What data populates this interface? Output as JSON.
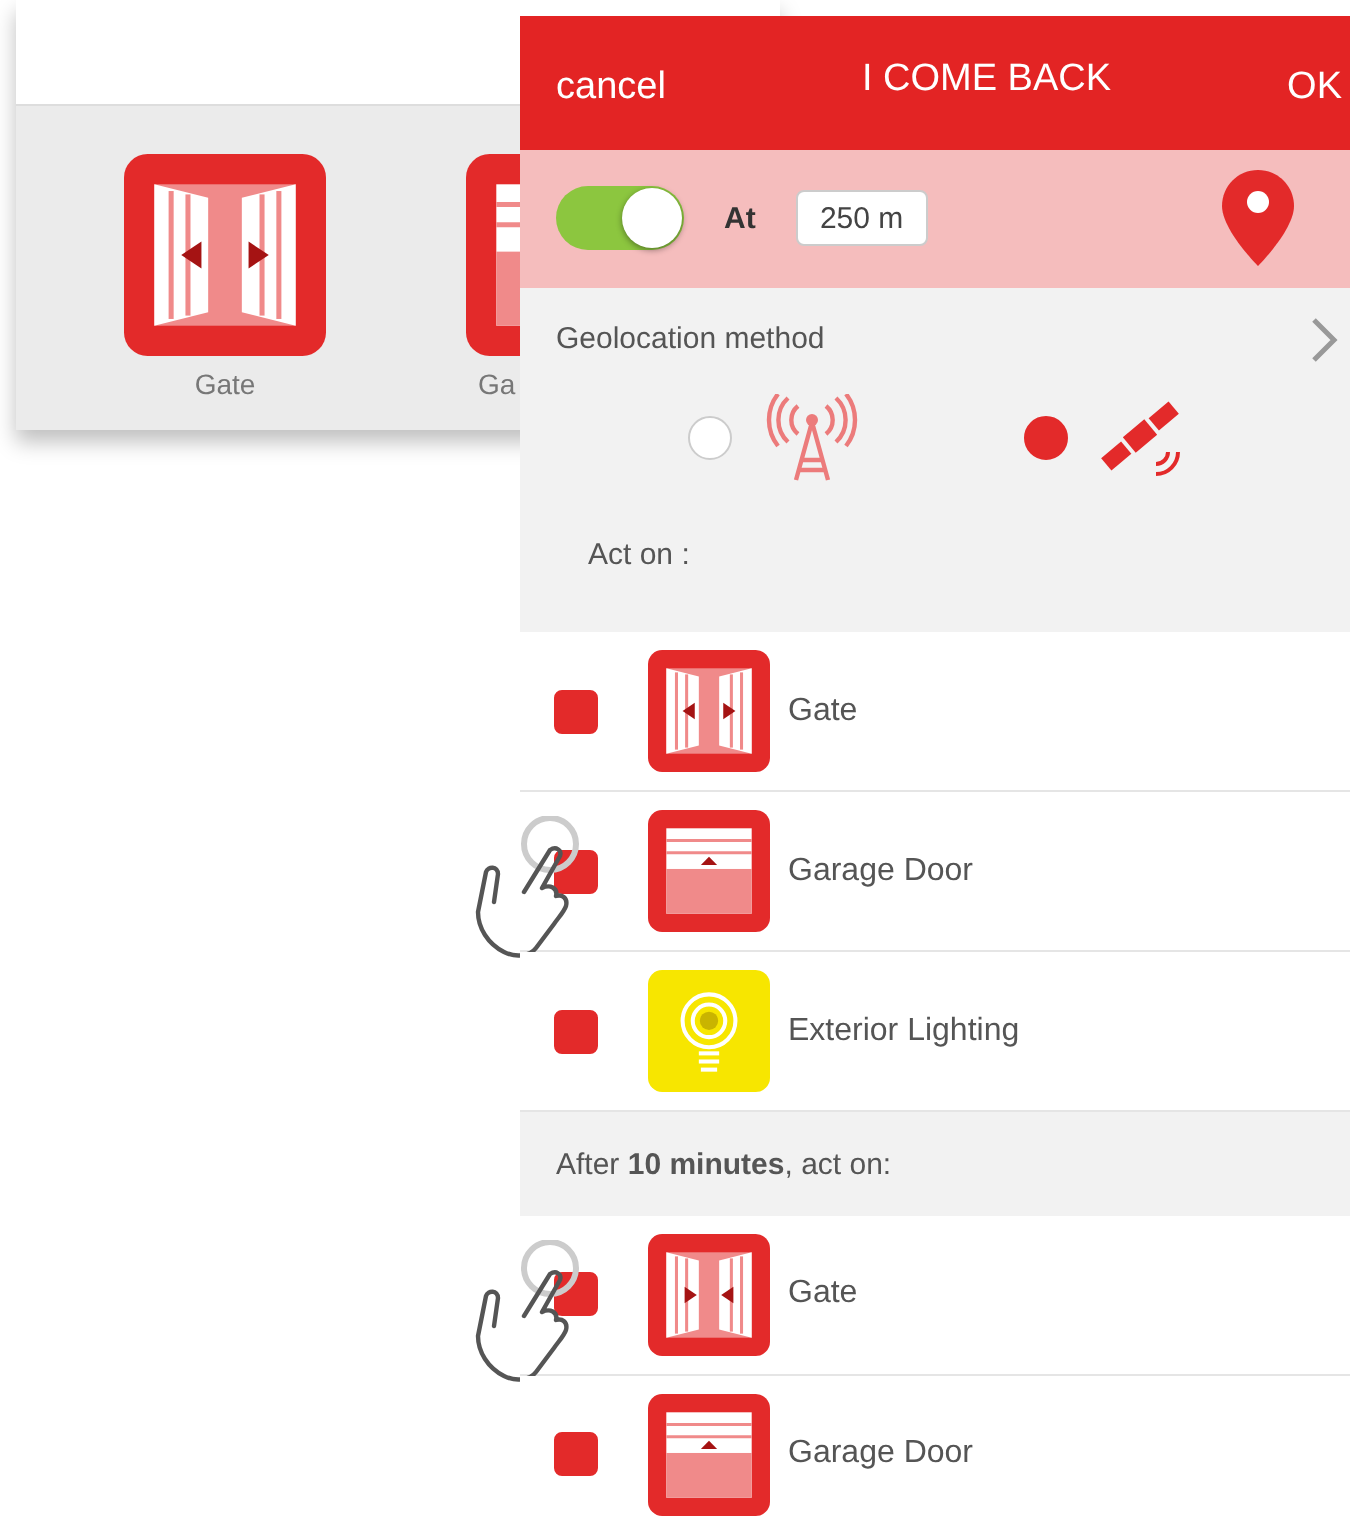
{
  "background_card": {
    "devices": [
      {
        "label": "Gate",
        "kind": "gate_open"
      },
      {
        "label": "Ga",
        "kind": "garage"
      }
    ]
  },
  "header": {
    "cancel": "cancel",
    "title": "I COME BACK",
    "ok": "OK"
  },
  "trigger": {
    "on": true,
    "label": "At",
    "distance": "250 m"
  },
  "geolocation": {
    "label": "Geolocation method",
    "options": [
      {
        "kind": "cell_tower",
        "selected": false
      },
      {
        "kind": "satellite",
        "selected": true
      }
    ]
  },
  "sections": [
    {
      "heading": "Act on :",
      "items": [
        {
          "label": "Gate",
          "kind": "gate_open",
          "checked": true,
          "touch_hint": false
        },
        {
          "label": "Garage Door",
          "kind": "garage",
          "checked": true,
          "touch_hint": true
        },
        {
          "label": "Exterior Lighting",
          "kind": "light",
          "checked": true,
          "touch_hint": false
        }
      ]
    },
    {
      "heading": "After **10 minutes**, act on:",
      "items": [
        {
          "label": "Gate",
          "kind": "gate_close",
          "checked": true,
          "touch_hint": true
        },
        {
          "label": "Garage Door",
          "kind": "garage",
          "checked": true,
          "touch_hint": false
        }
      ]
    }
  ]
}
